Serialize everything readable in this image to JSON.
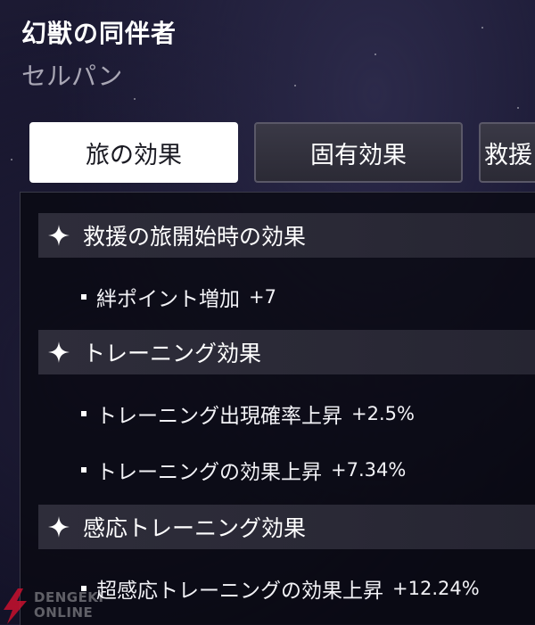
{
  "header": {
    "title": "幻獣の同伴者",
    "subtitle": "セルパン"
  },
  "tabs": [
    {
      "label": "旅の効果",
      "active": true
    },
    {
      "label": "固有効果",
      "active": false
    },
    {
      "label": "救援",
      "active": false
    }
  ],
  "sections": [
    {
      "icon": "sparkle-icon",
      "title": "救援の旅開始時の効果",
      "items": [
        {
          "label": "絆ポイント増加",
          "value": "+7"
        }
      ]
    },
    {
      "icon": "sparkle-icon",
      "title": "トレーニング効果",
      "items": [
        {
          "label": "トレーニング出現確率上昇",
          "value": "+2.5%"
        },
        {
          "label": "トレーニングの効果上昇",
          "value": "+7.34%"
        }
      ]
    },
    {
      "icon": "sparkle-icon",
      "title": "感応トレーニング効果",
      "items": [
        {
          "label": "超感応トレーニングの効果上昇",
          "value": "+12.24%"
        }
      ]
    }
  ],
  "watermark": {
    "line1": "DENGEKI",
    "line2": "ONLINE"
  },
  "colors": {
    "background": "#15142b",
    "panel": "#0b0b14",
    "section_bar": "#2e2d3a",
    "tab_active_bg": "#ffffff",
    "tab_inactive_bg": "#32313d",
    "subtitle": "#a8a6b4",
    "watermark_bolt": "#c8102e"
  }
}
